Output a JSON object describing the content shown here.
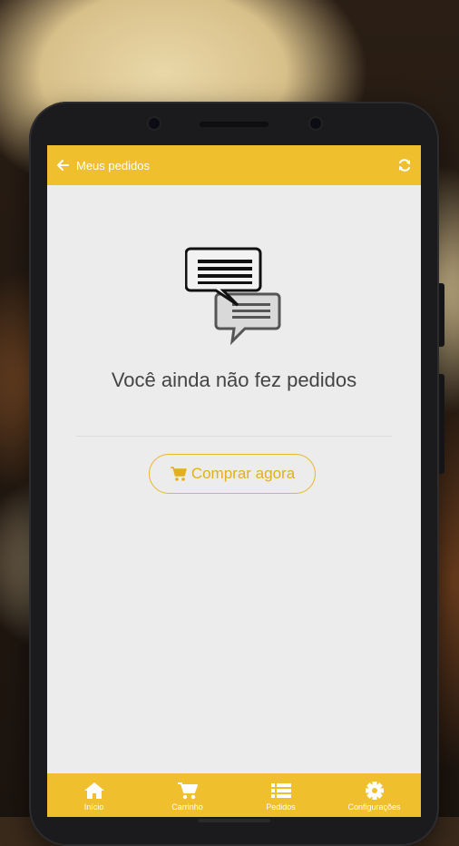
{
  "header": {
    "title": "Meus pedidos",
    "back_icon": "arrow-left-icon",
    "refresh_icon": "refresh-icon"
  },
  "empty_state": {
    "icon": "chat-bubbles-icon",
    "message": "Você ainda não fez pedidos",
    "cta_label": "Comprar agora",
    "cta_icon": "cart-icon"
  },
  "bottom_nav": [
    {
      "label": "Início",
      "icon": "home-icon"
    },
    {
      "label": "Carrinho",
      "icon": "cart-icon"
    },
    {
      "label": "Pedidos",
      "icon": "list-icon"
    },
    {
      "label": "Configurações",
      "icon": "gear-icon"
    }
  ],
  "colors": {
    "accent": "#f0bf2e",
    "cta": "#e3ae1f",
    "background": "#ececec",
    "text": "#444444"
  }
}
